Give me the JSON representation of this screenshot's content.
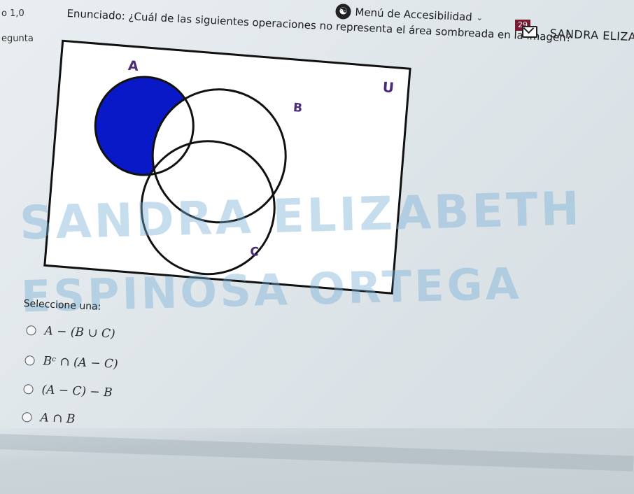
{
  "header": {
    "score": "o 1,0",
    "question_label": "egunta",
    "accessibility_menu": "Menú de Accesibilidad",
    "notification_count": "29",
    "user_name": "SANDRA ELIZA"
  },
  "question": {
    "stem": "Enunciado: ¿Cuál de las siguientes operaciones no representa el área sombreada en la imagen?",
    "venn": {
      "universe_label": "U",
      "set_a_label": "A",
      "set_b_label": "B",
      "set_c_label": "C",
      "shade_color": "#0a19c7",
      "label_color": "#4a2a7a"
    },
    "select_prompt": "Seleccione una:",
    "options": [
      "A − (B ∪ C)",
      "Bᶜ ∩ (A − C)",
      "(A − C) − B",
      "A ∩ B"
    ]
  },
  "watermark": {
    "line1": "SANDRA ELIZABETH",
    "line2": "ESPINOSA ORTEGA"
  }
}
